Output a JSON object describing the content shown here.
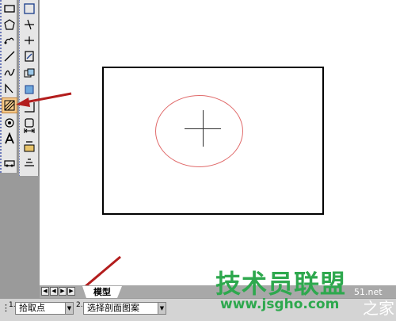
{
  "tabs": {
    "model_label": "模型"
  },
  "status": {
    "step1_num": "1.",
    "step1_value": "拾取点",
    "step2_num": "2.",
    "step2_value": "选择剖面图案"
  },
  "watermark": {
    "brand": "技术员联盟",
    "url": "www.jsgho.com",
    "partial_url": "51.net",
    "partial_text": "之家"
  },
  "colors": {
    "highlight_arrow": "#b31d1d",
    "circle": "#e06a6a",
    "watermark": "#2ea84e"
  },
  "toolbar1": {
    "icons": [
      "rectangle-icon",
      "polygon-icon",
      "revision-cloud-icon",
      "line-icon",
      "spline-icon",
      "ellipse-arc-icon",
      "dimension-icon",
      "hatch-icon",
      "region-icon",
      "text-icon",
      "block-icon"
    ]
  },
  "toolbar2": {
    "icons": [
      "rectangle-frame-icon",
      "extend-icon",
      "trim-icon",
      "insert-icon",
      "copy-icon",
      "refedit-icon",
      "hatch-boundary-icon",
      "move-icon",
      "stretch-icon",
      "match-icon",
      "layer-icon"
    ]
  }
}
